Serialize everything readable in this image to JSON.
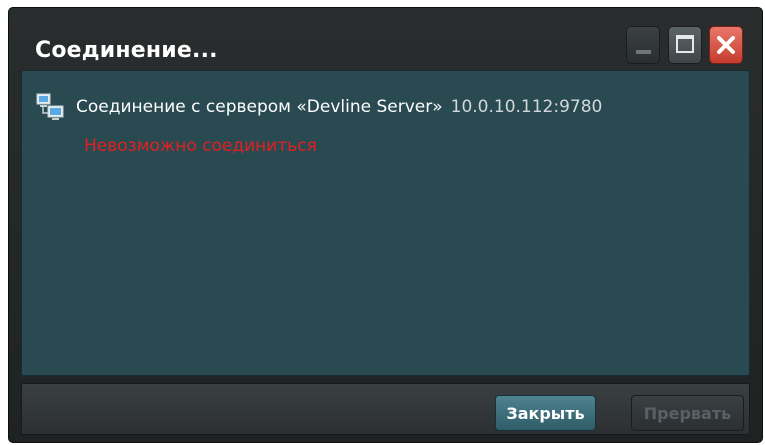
{
  "window": {
    "title": "Соединение..."
  },
  "connection": {
    "message": "Соединение с сервером «Devline Server»",
    "address": "10.0.10.112:9780",
    "error": "Невозможно соединиться"
  },
  "buttons": {
    "close_label": "Закрыть",
    "abort_label": "Прервать"
  },
  "icons": {
    "network": "network-computers-icon",
    "minimize": "minimize-icon",
    "maximize": "maximize-icon",
    "close": "close-icon"
  },
  "colors": {
    "content_bg": "#2a4a52",
    "error_text": "#e31f1f",
    "close_button": "#c43c2e",
    "primary_button": "#3e7380"
  }
}
